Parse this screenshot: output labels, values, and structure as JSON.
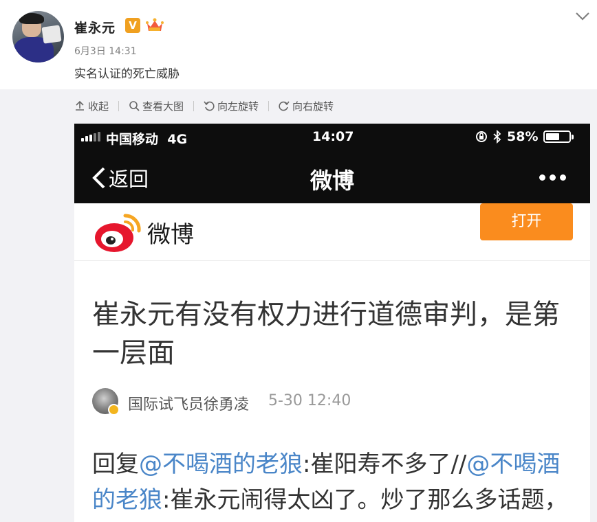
{
  "post": {
    "username": "崔永元",
    "verified_badge": "V",
    "member_icon": "member-crown-icon",
    "time": "6月3日 14:31",
    "text": "实名认证的死亡威胁"
  },
  "toolbar": {
    "collapse": "收起",
    "view_large": "查看大图",
    "rotate_left": "向左旋转",
    "rotate_right": "向右旋转"
  },
  "screenshot": {
    "status": {
      "carrier": "中国移动",
      "network": "4G",
      "time": "14:07",
      "battery": "58%",
      "battery_level": 0.58
    },
    "nav": {
      "back": "返回",
      "title": "微博"
    },
    "banner": {
      "brand": "微博",
      "open_button": "打开"
    },
    "article": {
      "title": "崔永元有没有权力进行道德审判，是第一层面",
      "author": "国际试飞员徐勇凌",
      "time": "5-30 12:40"
    },
    "reply": {
      "prefix": "回复",
      "mention1": "@不喝酒的老狼",
      "text1": ":崔阳寿不多了//",
      "mention2": "@不喝酒的老狼",
      "text2": ":崔永元闹得太凶了。炒了那么多话题，"
    }
  },
  "colors": {
    "orange_button": "#fa8c1e",
    "mention_blue": "#4a86c8",
    "verified_orange": "#f0a020",
    "weibo_red": "#e6162d"
  }
}
